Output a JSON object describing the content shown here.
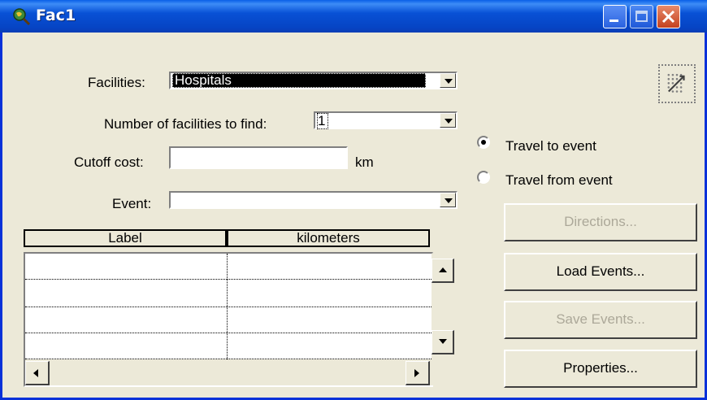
{
  "window": {
    "title": "Fac1",
    "min_icon": "minimize-icon",
    "max_icon": "maximize-icon",
    "close_icon": "close-icon"
  },
  "form": {
    "facilities_label": "Facilities:",
    "facilities_value": "Hospitals",
    "num_label": "Number of facilities to find:",
    "num_value": "1",
    "cutoff_label": "Cutoff cost:",
    "cutoff_value": "",
    "cutoff_unit": "km",
    "event_label": "Event:",
    "event_value": ""
  },
  "table": {
    "columns": [
      "Label",
      "kilometers"
    ],
    "rows": [
      [
        "",
        ""
      ],
      [
        "",
        ""
      ],
      [
        "",
        ""
      ],
      [
        "",
        ""
      ]
    ]
  },
  "options": {
    "travel_to": "Travel to event",
    "travel_from": "Travel from event",
    "selected": "Travel to event"
  },
  "buttons": {
    "directions": "Directions...",
    "load_events": "Load Events...",
    "save_events": "Save Events...",
    "properties": "Properties..."
  },
  "colors": {
    "titlebar": "#0a5fe8",
    "face": "#ece9d8",
    "disabled_text": "#aca899"
  }
}
